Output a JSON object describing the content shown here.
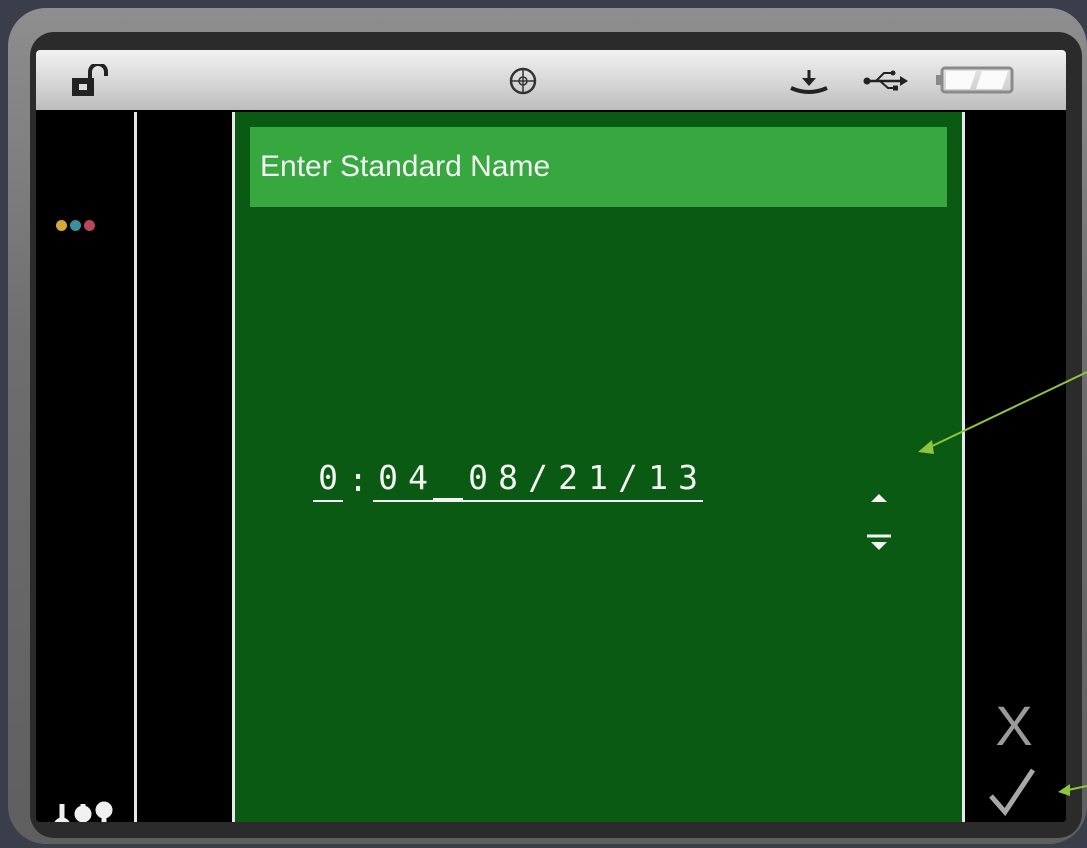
{
  "status_bar": {
    "icons": [
      "unlock-icon",
      "target-icon",
      "download-icon",
      "usb-icon",
      "battery-icon"
    ]
  },
  "sidebar": {
    "indicator_colors": [
      "#d4a93a",
      "#3a8f9a",
      "#b8485a"
    ],
    "bottom_icon": "sliders-icon"
  },
  "dialog": {
    "title": "Enter Standard Name",
    "name_chars": [
      "0",
      ":",
      "0",
      "4",
      "_",
      "0",
      "8",
      "/",
      "2",
      "1",
      "/",
      "1",
      "3"
    ]
  },
  "actions": {
    "cancel_label": "X",
    "confirm_icon": "checkmark-icon"
  },
  "colors": {
    "panel_green": "#0a5a14",
    "title_green": "#37a83f",
    "arrow_green": "#8cc63f"
  }
}
